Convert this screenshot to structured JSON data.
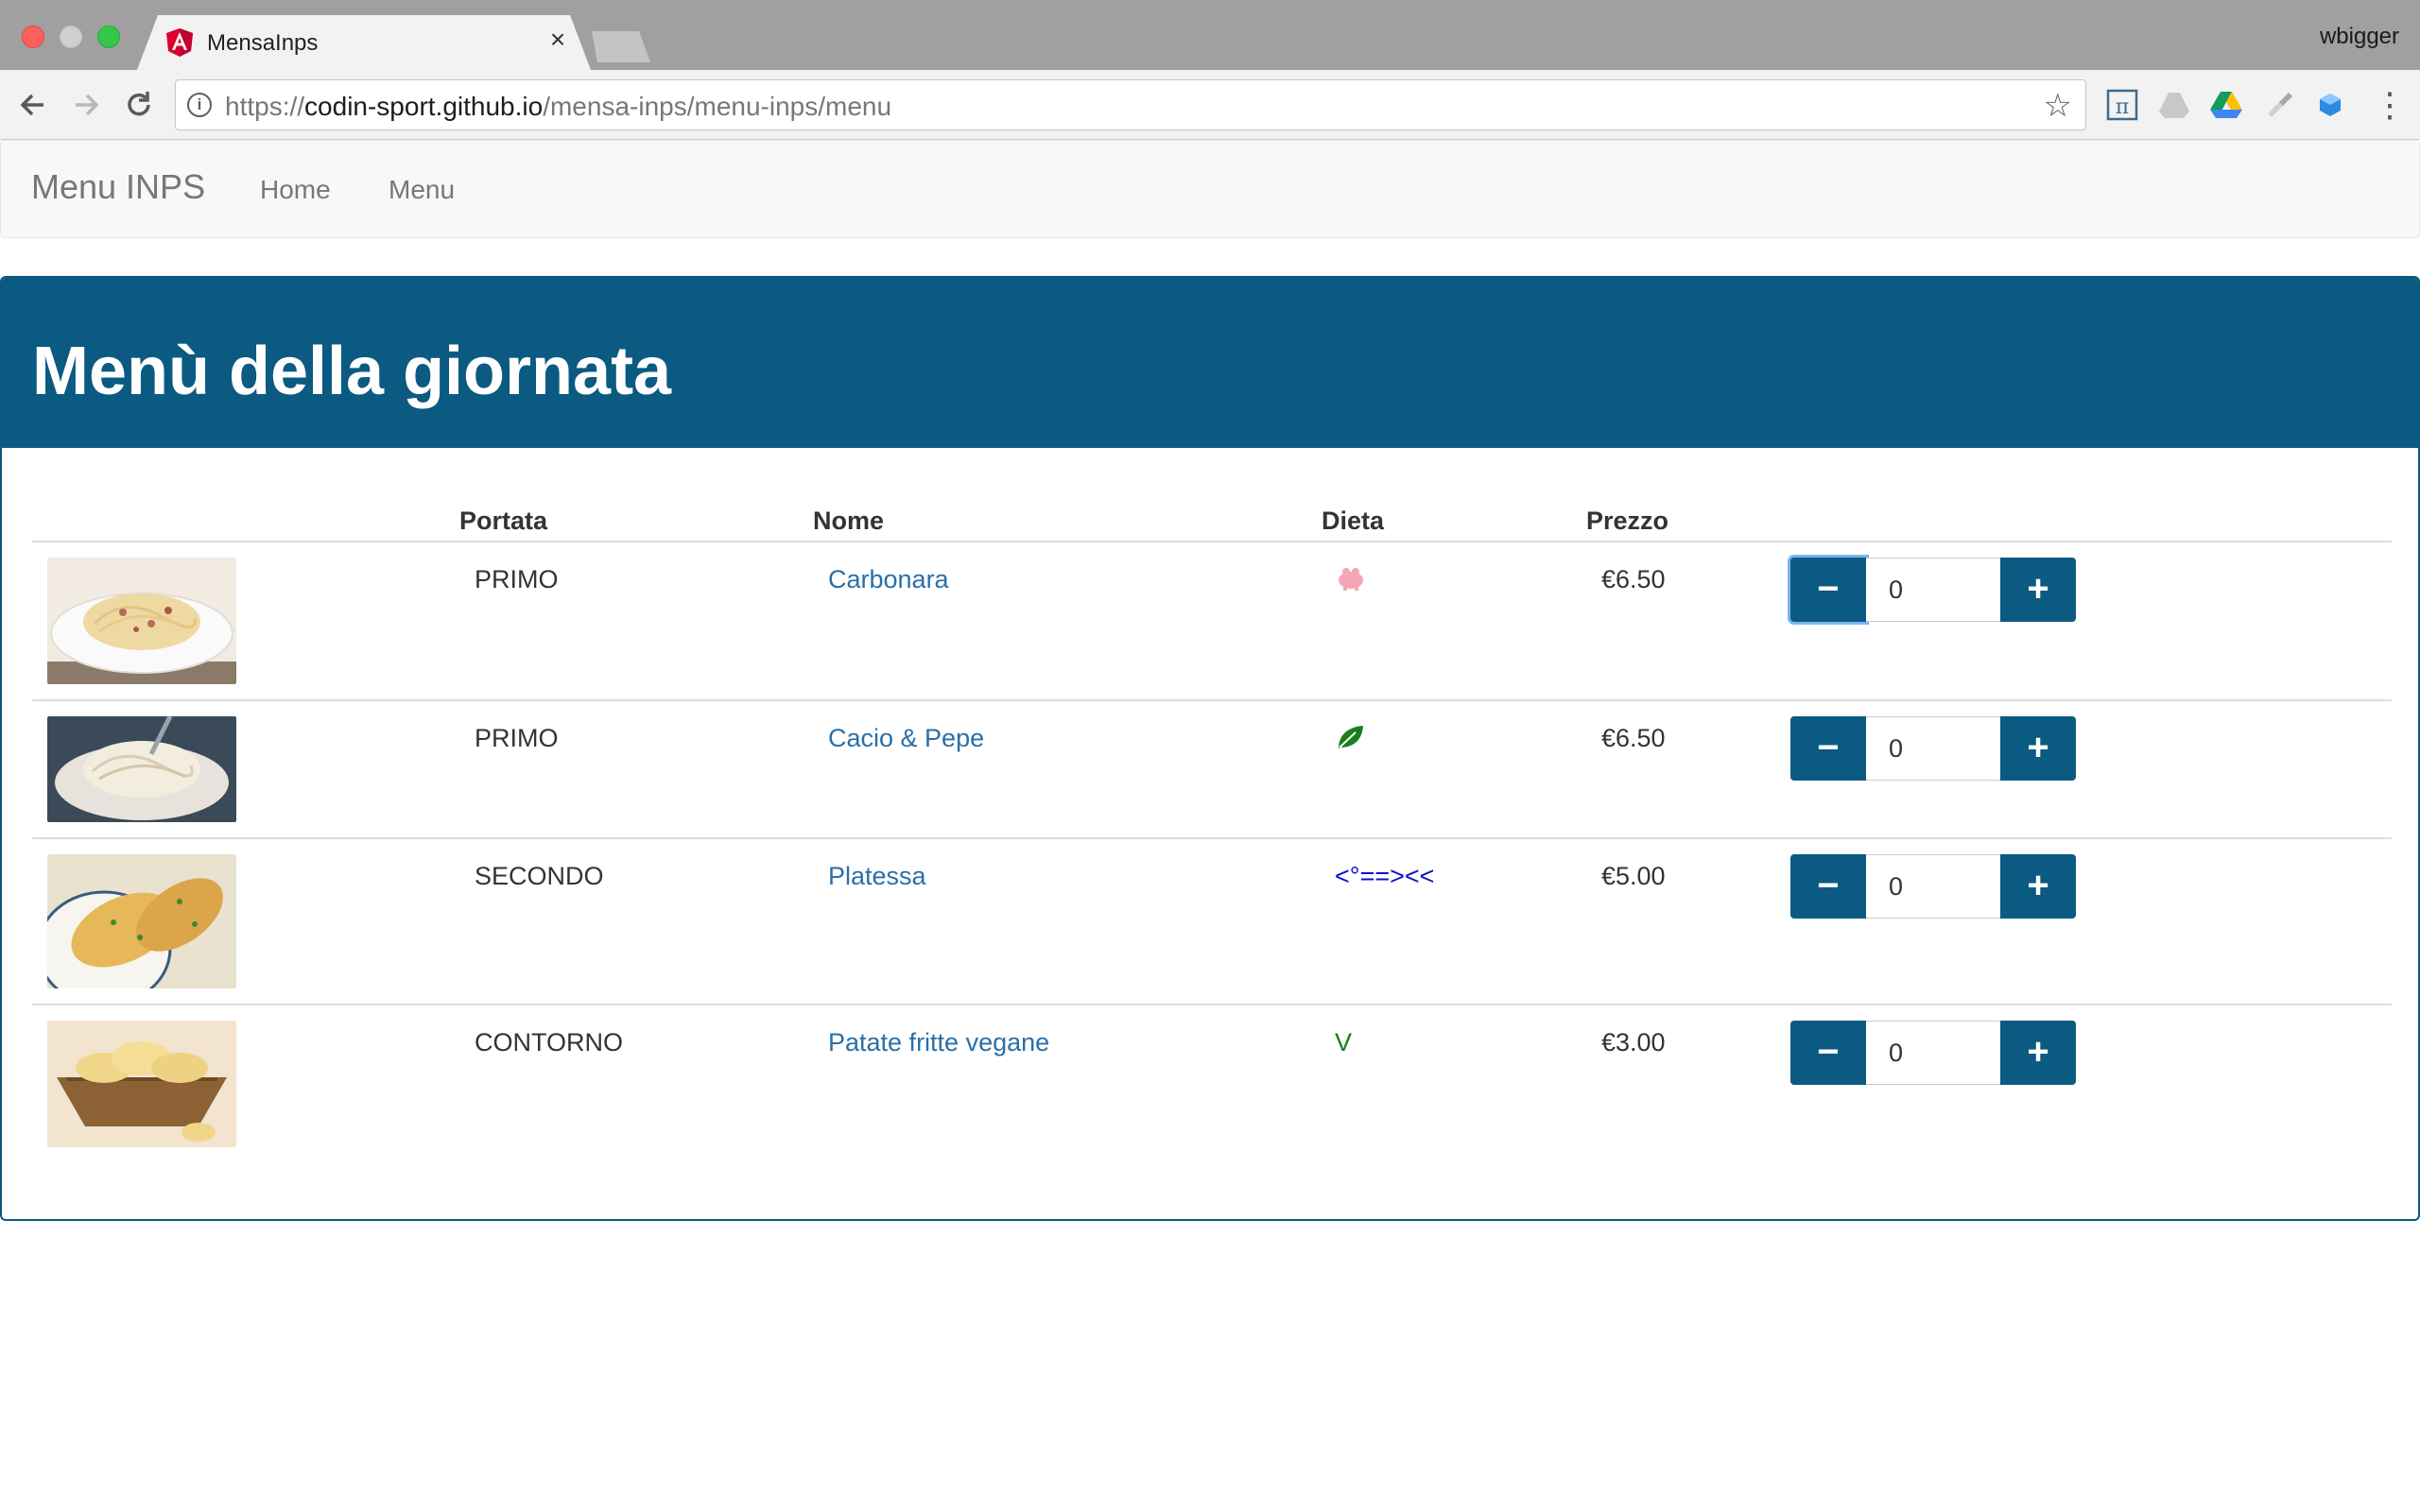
{
  "browser": {
    "tab_title": "MensaInps",
    "tab_close": "×",
    "profile_name": "wbigger",
    "url_scheme": "https://",
    "url_host": "codin-sport.github.io",
    "url_path": "/mensa-inps/menu-inps/menu"
  },
  "navbar": {
    "brand": "Menu INPS",
    "links": [
      "Home",
      "Menu"
    ]
  },
  "panel": {
    "title": "Menù della giornata"
  },
  "table": {
    "headers": [
      "Portata",
      "Nome",
      "Dieta",
      "Prezzo"
    ],
    "rows": [
      {
        "course": "PRIMO",
        "name": "Carbonara",
        "diet": "pig-icon",
        "price": "€6.50",
        "qty": "0"
      },
      {
        "course": "PRIMO",
        "name": "Cacio & Pepe",
        "diet": "leaf-icon",
        "price": "€6.50",
        "qty": "0"
      },
      {
        "course": "SECONDO",
        "name": "Platessa",
        "diet_text": "<°==><<",
        "price": "€5.00",
        "qty": "0"
      },
      {
        "course": "CONTORNO",
        "name": "Patate fritte vegane",
        "diet_text": "V",
        "price": "€3.00",
        "qty": "0"
      }
    ]
  },
  "colors": {
    "primary": "#0b5a82",
    "link": "#2a6fa8",
    "pig": "#f4a6b6",
    "leaf": "#1a7f1a",
    "fish": "#1010d0",
    "vegan": "#1a7f1a"
  }
}
